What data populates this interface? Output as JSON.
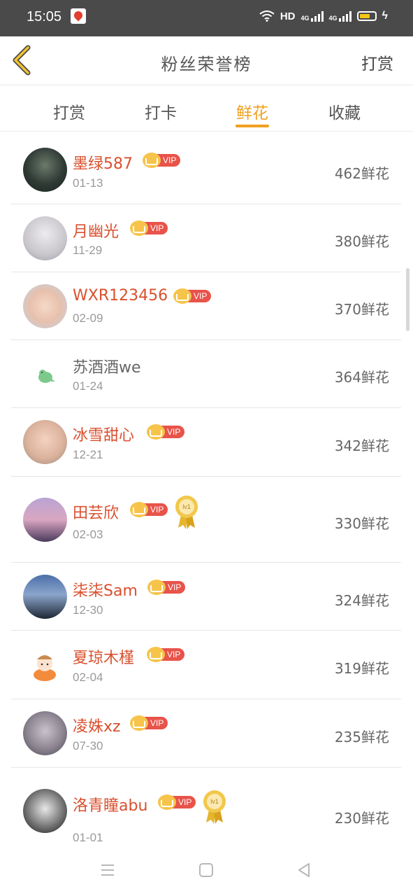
{
  "status": {
    "time": "15:05",
    "network": "HD",
    "sig1": "4G",
    "sig2": "4G"
  },
  "header": {
    "title": "粉丝荣誉榜",
    "right_action": "打赏"
  },
  "tabs": [
    {
      "label": "打赏",
      "active": false
    },
    {
      "label": "打卡",
      "active": false
    },
    {
      "label": "鲜花",
      "active": true
    },
    {
      "label": "收藏",
      "active": false
    }
  ],
  "list": [
    {
      "name": "墨绿587",
      "date": "01-13",
      "amount": "462鲜花",
      "vip": "VIP",
      "medal": ""
    },
    {
      "name": "月幽光",
      "date": "11-29",
      "amount": "380鲜花",
      "vip": "VIP",
      "medal": ""
    },
    {
      "name": "WXR123456",
      "date": "02-09",
      "amount": "370鲜花",
      "vip": "VIP",
      "medal": ""
    },
    {
      "name": "苏酒酒we",
      "date": "01-24",
      "amount": "364鲜花",
      "vip": "",
      "medal": ""
    },
    {
      "name": "冰雪甜心",
      "date": "12-21",
      "amount": "342鲜花",
      "vip": "VIP",
      "medal": ""
    },
    {
      "name": "田芸欣",
      "date": "02-03",
      "amount": "330鲜花",
      "vip": "VIP",
      "medal": "lv1"
    },
    {
      "name": "柒柒Sam",
      "date": "12-30",
      "amount": "324鲜花",
      "vip": "VIP",
      "medal": ""
    },
    {
      "name": "夏琼木槿",
      "date": "02-04",
      "amount": "319鲜花",
      "vip": "VIP",
      "medal": ""
    },
    {
      "name": "凌姝xz",
      "date": "07-30",
      "amount": "235鲜花",
      "vip": "VIP",
      "medal": ""
    },
    {
      "name": "洛青瞳abu",
      "date": "01-01",
      "amount": "230鲜花",
      "vip": "VIP",
      "medal": "lv1"
    }
  ],
  "colors": {
    "accent": "#f0a020",
    "name_red": "#d9502e",
    "vip_red": "#e8534a",
    "vip_gold": "#f6c44a"
  },
  "icons": {
    "back": "back-chevron-icon",
    "menu": "menu-lines-icon",
    "home": "home-square-icon",
    "back_nav": "back-triangle-icon"
  }
}
